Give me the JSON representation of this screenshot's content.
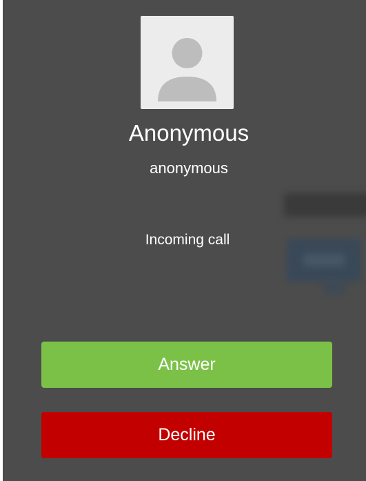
{
  "caller": {
    "display_name": "Anonymous",
    "username": "anonymous",
    "avatar_icon": "default-user-avatar-icon"
  },
  "call": {
    "status": "Incoming call"
  },
  "actions": {
    "answer_label": "Answer",
    "decline_label": "Decline"
  },
  "colors": {
    "overlay": "#4c4c4c",
    "answer": "#7bc147",
    "decline": "#c20000",
    "avatar_bg": "#ececec",
    "avatar_icon": "#bdbdbd"
  }
}
